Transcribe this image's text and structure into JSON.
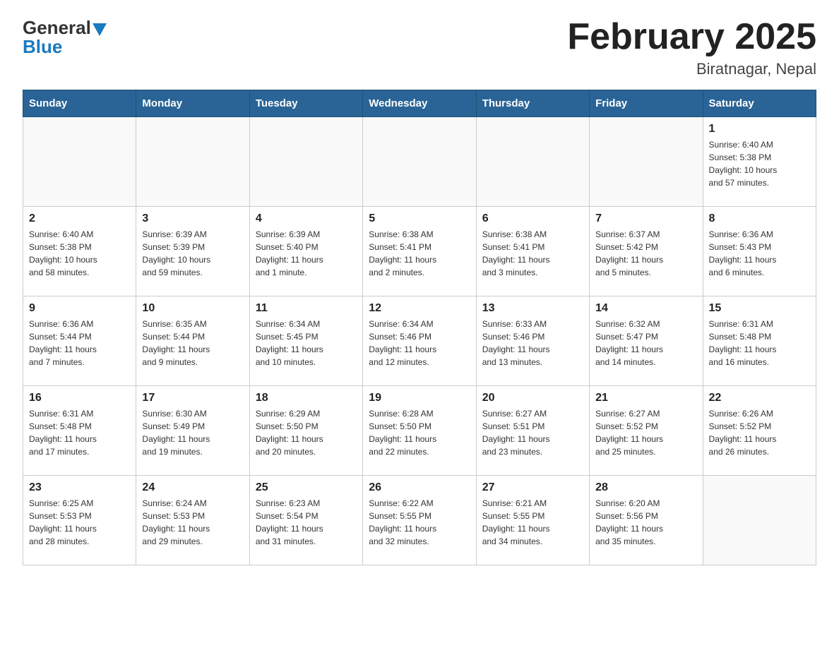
{
  "header": {
    "logo_general": "General",
    "logo_blue": "Blue",
    "title": "February 2025",
    "location": "Biratnagar, Nepal"
  },
  "days_of_week": [
    "Sunday",
    "Monday",
    "Tuesday",
    "Wednesday",
    "Thursday",
    "Friday",
    "Saturday"
  ],
  "weeks": [
    [
      {
        "day": "",
        "info": ""
      },
      {
        "day": "",
        "info": ""
      },
      {
        "day": "",
        "info": ""
      },
      {
        "day": "",
        "info": ""
      },
      {
        "day": "",
        "info": ""
      },
      {
        "day": "",
        "info": ""
      },
      {
        "day": "1",
        "info": "Sunrise: 6:40 AM\nSunset: 5:38 PM\nDaylight: 10 hours\nand 57 minutes."
      }
    ],
    [
      {
        "day": "2",
        "info": "Sunrise: 6:40 AM\nSunset: 5:38 PM\nDaylight: 10 hours\nand 58 minutes."
      },
      {
        "day": "3",
        "info": "Sunrise: 6:39 AM\nSunset: 5:39 PM\nDaylight: 10 hours\nand 59 minutes."
      },
      {
        "day": "4",
        "info": "Sunrise: 6:39 AM\nSunset: 5:40 PM\nDaylight: 11 hours\nand 1 minute."
      },
      {
        "day": "5",
        "info": "Sunrise: 6:38 AM\nSunset: 5:41 PM\nDaylight: 11 hours\nand 2 minutes."
      },
      {
        "day": "6",
        "info": "Sunrise: 6:38 AM\nSunset: 5:41 PM\nDaylight: 11 hours\nand 3 minutes."
      },
      {
        "day": "7",
        "info": "Sunrise: 6:37 AM\nSunset: 5:42 PM\nDaylight: 11 hours\nand 5 minutes."
      },
      {
        "day": "8",
        "info": "Sunrise: 6:36 AM\nSunset: 5:43 PM\nDaylight: 11 hours\nand 6 minutes."
      }
    ],
    [
      {
        "day": "9",
        "info": "Sunrise: 6:36 AM\nSunset: 5:44 PM\nDaylight: 11 hours\nand 7 minutes."
      },
      {
        "day": "10",
        "info": "Sunrise: 6:35 AM\nSunset: 5:44 PM\nDaylight: 11 hours\nand 9 minutes."
      },
      {
        "day": "11",
        "info": "Sunrise: 6:34 AM\nSunset: 5:45 PM\nDaylight: 11 hours\nand 10 minutes."
      },
      {
        "day": "12",
        "info": "Sunrise: 6:34 AM\nSunset: 5:46 PM\nDaylight: 11 hours\nand 12 minutes."
      },
      {
        "day": "13",
        "info": "Sunrise: 6:33 AM\nSunset: 5:46 PM\nDaylight: 11 hours\nand 13 minutes."
      },
      {
        "day": "14",
        "info": "Sunrise: 6:32 AM\nSunset: 5:47 PM\nDaylight: 11 hours\nand 14 minutes."
      },
      {
        "day": "15",
        "info": "Sunrise: 6:31 AM\nSunset: 5:48 PM\nDaylight: 11 hours\nand 16 minutes."
      }
    ],
    [
      {
        "day": "16",
        "info": "Sunrise: 6:31 AM\nSunset: 5:48 PM\nDaylight: 11 hours\nand 17 minutes."
      },
      {
        "day": "17",
        "info": "Sunrise: 6:30 AM\nSunset: 5:49 PM\nDaylight: 11 hours\nand 19 minutes."
      },
      {
        "day": "18",
        "info": "Sunrise: 6:29 AM\nSunset: 5:50 PM\nDaylight: 11 hours\nand 20 minutes."
      },
      {
        "day": "19",
        "info": "Sunrise: 6:28 AM\nSunset: 5:50 PM\nDaylight: 11 hours\nand 22 minutes."
      },
      {
        "day": "20",
        "info": "Sunrise: 6:27 AM\nSunset: 5:51 PM\nDaylight: 11 hours\nand 23 minutes."
      },
      {
        "day": "21",
        "info": "Sunrise: 6:27 AM\nSunset: 5:52 PM\nDaylight: 11 hours\nand 25 minutes."
      },
      {
        "day": "22",
        "info": "Sunrise: 6:26 AM\nSunset: 5:52 PM\nDaylight: 11 hours\nand 26 minutes."
      }
    ],
    [
      {
        "day": "23",
        "info": "Sunrise: 6:25 AM\nSunset: 5:53 PM\nDaylight: 11 hours\nand 28 minutes."
      },
      {
        "day": "24",
        "info": "Sunrise: 6:24 AM\nSunset: 5:53 PM\nDaylight: 11 hours\nand 29 minutes."
      },
      {
        "day": "25",
        "info": "Sunrise: 6:23 AM\nSunset: 5:54 PM\nDaylight: 11 hours\nand 31 minutes."
      },
      {
        "day": "26",
        "info": "Sunrise: 6:22 AM\nSunset: 5:55 PM\nDaylight: 11 hours\nand 32 minutes."
      },
      {
        "day": "27",
        "info": "Sunrise: 6:21 AM\nSunset: 5:55 PM\nDaylight: 11 hours\nand 34 minutes."
      },
      {
        "day": "28",
        "info": "Sunrise: 6:20 AM\nSunset: 5:56 PM\nDaylight: 11 hours\nand 35 minutes."
      },
      {
        "day": "",
        "info": ""
      }
    ]
  ]
}
